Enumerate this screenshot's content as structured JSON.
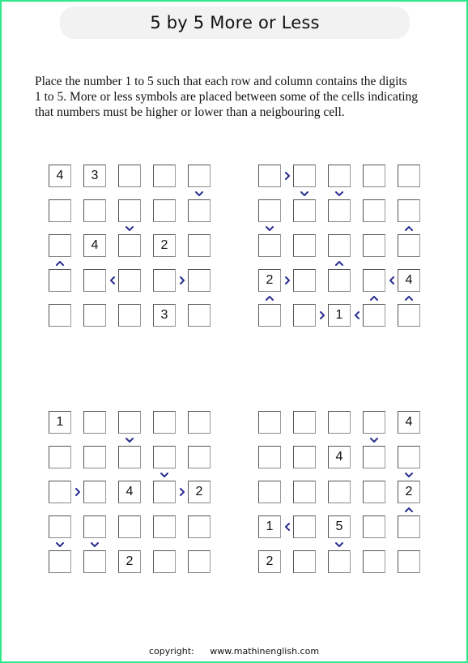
{
  "title": "5 by 5 More or Less",
  "instructions": [
    "Place the number 1 to 5 such that each row and column contains the digits",
    "1 to 5. More or less symbols are placed between some of the cells indicating",
    "that numbers must be higher or lower than a neigbouring cell."
  ],
  "symbol_color": "#2b2f8f",
  "puzzles": [
    {
      "name": "top-left",
      "givens": [
        [
          "4",
          "3",
          "",
          "",
          ""
        ],
        [
          "",
          "",
          "",
          "",
          ""
        ],
        [
          "",
          "4",
          "",
          "2",
          ""
        ],
        [
          "",
          "",
          "",
          "",
          ""
        ],
        [
          "",
          "",
          "",
          "3",
          ""
        ]
      ],
      "horizontal_symbols": [
        {
          "row": 3,
          "after_col": 1,
          "symbol": "<"
        },
        {
          "row": 3,
          "after_col": 3,
          "symbol": ">"
        }
      ],
      "vertical_symbols": [
        {
          "col": 4,
          "after_row": 0,
          "symbol": "v"
        },
        {
          "col": 2,
          "after_row": 1,
          "symbol": "v"
        },
        {
          "col": 0,
          "after_row": 2,
          "symbol": "^"
        }
      ]
    },
    {
      "name": "top-right",
      "givens": [
        [
          "",
          "",
          "",
          "",
          ""
        ],
        [
          "",
          "",
          "",
          "",
          ""
        ],
        [
          "",
          "",
          "",
          "",
          ""
        ],
        [
          "2",
          "",
          "",
          "",
          "4"
        ],
        [
          "",
          "",
          "1",
          "",
          ""
        ]
      ],
      "horizontal_symbols": [
        {
          "row": 0,
          "after_col": 0,
          "symbol": ">"
        },
        {
          "row": 3,
          "after_col": 0,
          "symbol": ">"
        },
        {
          "row": 3,
          "after_col": 3,
          "symbol": "<"
        },
        {
          "row": 4,
          "after_col": 1,
          "symbol": ">"
        },
        {
          "row": 4,
          "after_col": 2,
          "symbol": "<"
        }
      ],
      "vertical_symbols": [
        {
          "col": 1,
          "after_row": 0,
          "symbol": "v"
        },
        {
          "col": 2,
          "after_row": 0,
          "symbol": "v"
        },
        {
          "col": 0,
          "after_row": 1,
          "symbol": "v"
        },
        {
          "col": 4,
          "after_row": 1,
          "symbol": "^"
        },
        {
          "col": 2,
          "after_row": 2,
          "symbol": "^"
        },
        {
          "col": 0,
          "after_row": 3,
          "symbol": "^"
        },
        {
          "col": 3,
          "after_row": 3,
          "symbol": "^"
        },
        {
          "col": 4,
          "after_row": 3,
          "symbol": "^"
        }
      ]
    },
    {
      "name": "bottom-left",
      "givens": [
        [
          "1",
          "",
          "",
          "",
          ""
        ],
        [
          "",
          "",
          "",
          "",
          ""
        ],
        [
          "",
          "",
          "4",
          "",
          "2"
        ],
        [
          "",
          "",
          "",
          "",
          ""
        ],
        [
          "",
          "",
          "2",
          "",
          ""
        ]
      ],
      "horizontal_symbols": [
        {
          "row": 2,
          "after_col": 0,
          "symbol": ">"
        },
        {
          "row": 2,
          "after_col": 3,
          "symbol": ">"
        }
      ],
      "vertical_symbols": [
        {
          "col": 2,
          "after_row": 0,
          "symbol": "v"
        },
        {
          "col": 3,
          "after_row": 1,
          "symbol": "v"
        },
        {
          "col": 0,
          "after_row": 3,
          "symbol": "v"
        },
        {
          "col": 1,
          "after_row": 3,
          "symbol": "v"
        }
      ]
    },
    {
      "name": "bottom-right",
      "givens": [
        [
          "",
          "",
          "",
          "",
          "4"
        ],
        [
          "",
          "",
          "4",
          "",
          ""
        ],
        [
          "",
          "",
          "",
          "",
          "2"
        ],
        [
          "1",
          "",
          "5",
          "",
          ""
        ],
        [
          "2",
          "",
          "",
          "",
          ""
        ]
      ],
      "horizontal_symbols": [
        {
          "row": 3,
          "after_col": 0,
          "symbol": "<"
        }
      ],
      "vertical_symbols": [
        {
          "col": 3,
          "after_row": 0,
          "symbol": "v"
        },
        {
          "col": 4,
          "after_row": 1,
          "symbol": "v"
        },
        {
          "col": 4,
          "after_row": 2,
          "symbol": "^"
        },
        {
          "col": 2,
          "after_row": 3,
          "symbol": "v"
        }
      ]
    }
  ],
  "footer": {
    "copyright_label": "copyright:",
    "website": "www.mathinenglish.com"
  }
}
